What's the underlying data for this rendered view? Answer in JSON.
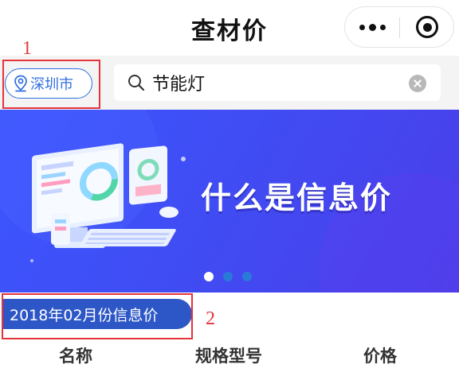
{
  "header": {
    "title": "查材价",
    "menu_icon": "more-dots-icon",
    "close_icon": "target-circle-icon"
  },
  "search_bar": {
    "city_label": "深圳市",
    "city_icon": "location-pin-icon",
    "search_icon": "magnifier-icon",
    "query": "节能灯",
    "clear_icon": "clear-circle-icon"
  },
  "banner": {
    "slogan": "什么是信息价",
    "illustration": "computer-illustration",
    "carousel_total": 3,
    "carousel_active": 1
  },
  "period_tag": {
    "label": "2018年02月份信息价"
  },
  "table": {
    "columns": [
      "名称",
      "规格型号",
      "价格"
    ]
  },
  "annotations": [
    {
      "label": "1"
    },
    {
      "label": "2"
    }
  ],
  "colors": {
    "accent": "#2f6fe0",
    "tag_bg": "#2d57c6",
    "banner_bg": "#3f4ef5",
    "annotation_red": "#e6333a",
    "caret": "#07c160"
  }
}
